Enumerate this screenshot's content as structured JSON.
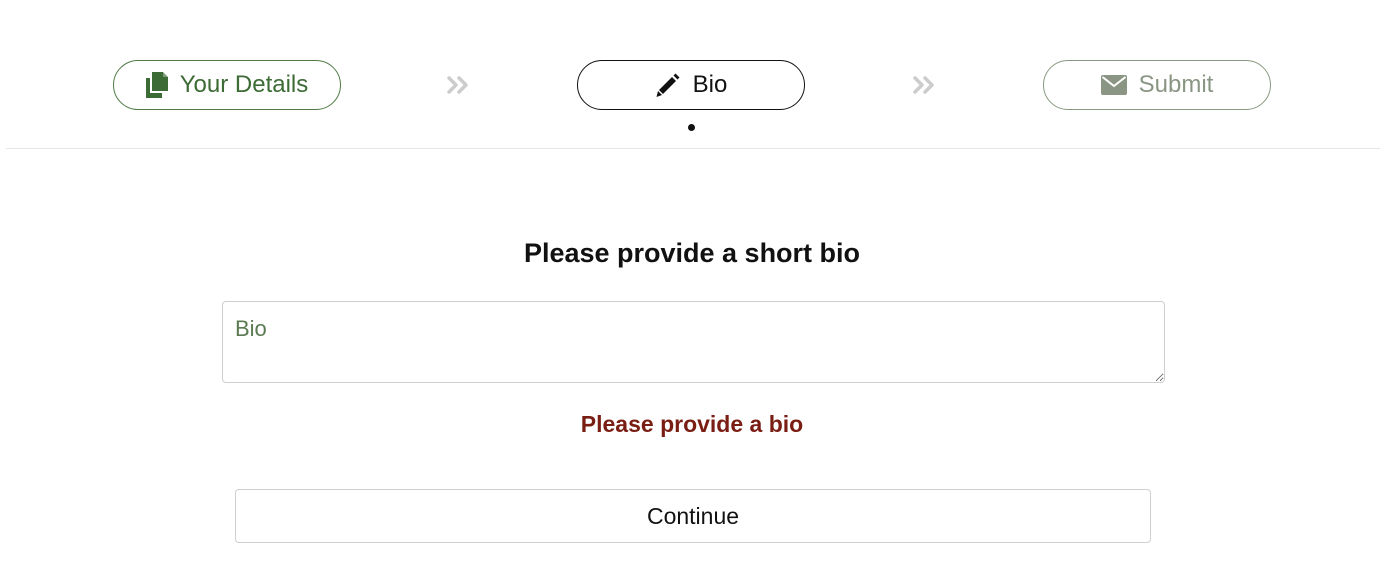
{
  "stepper": {
    "steps": [
      {
        "label": "Your Details",
        "icon": "copy-icon",
        "state": "completed",
        "color": "#3d6b35"
      },
      {
        "label": "Bio",
        "icon": "pencil-icon",
        "state": "active",
        "color": "#111111"
      },
      {
        "label": "Submit",
        "icon": "envelope-icon",
        "state": "upcoming",
        "color": "#8a9683"
      }
    ],
    "separator_icon": "double-chevron-right-icon"
  },
  "form": {
    "title": "Please provide a short bio",
    "bio_placeholder": "Bio",
    "bio_value": "",
    "error": "Please provide a bio",
    "continue_label": "Continue"
  },
  "colors": {
    "accent": "#3d6b35",
    "error": "#7a1e14",
    "separator": "#cccccc"
  }
}
